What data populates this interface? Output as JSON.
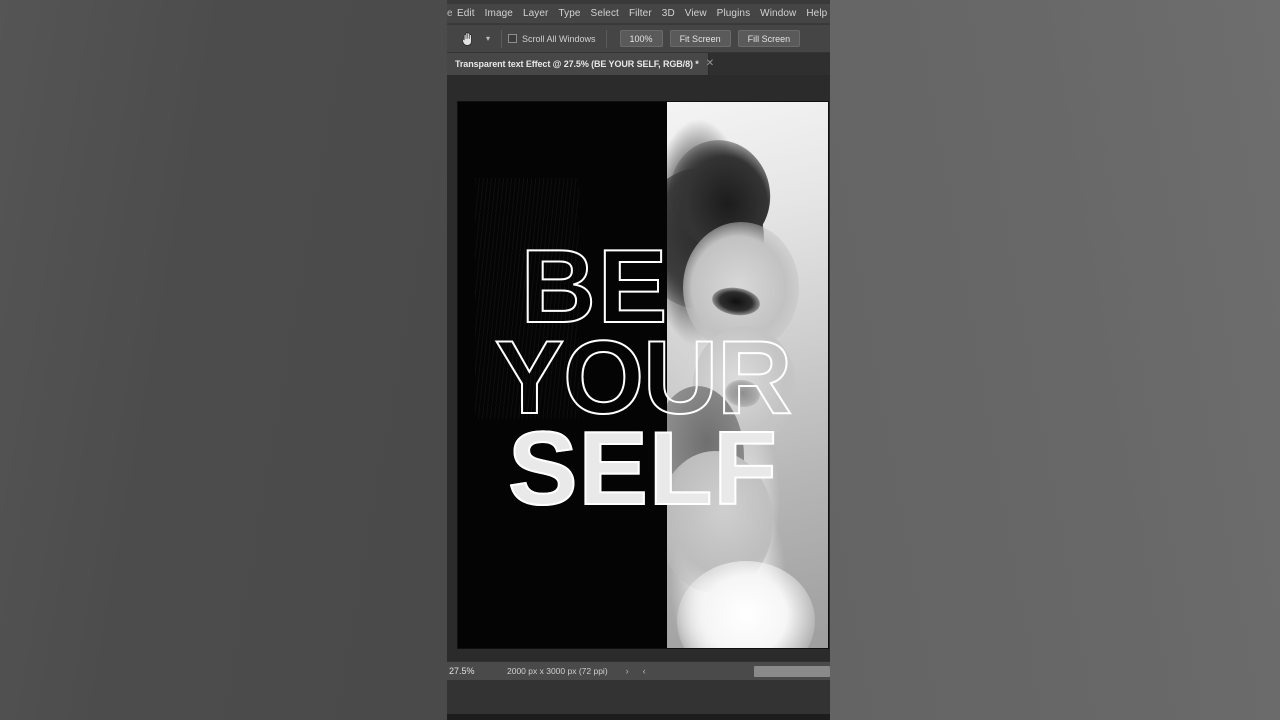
{
  "app": {
    "menu": {
      "truncated_first": "e",
      "items": [
        "Edit",
        "Image",
        "Layer",
        "Type",
        "Select",
        "Filter",
        "3D",
        "View",
        "Plugins",
        "Window",
        "Help"
      ]
    },
    "options_bar": {
      "tool_icon": "hand-tool-icon",
      "preset_chevron_icon": "chevron-down-icon",
      "scroll_all_windows_label": "Scroll All Windows",
      "scroll_all_windows_checked": false,
      "buttons": [
        "100%",
        "Fit Screen",
        "Fill Screen"
      ]
    },
    "tab": {
      "title": "Transparent text Effect @ 27.5% (BE YOUR SELF, RGB/8) *",
      "close_icon": "close-icon"
    },
    "status_bar": {
      "zoom": "27.5%",
      "doc_size": "2000 px x 3000 px (72 ppi)",
      "arrow_right_icon": "›",
      "arrow_left_icon": "‹"
    }
  },
  "artwork": {
    "headline": {
      "line1": "BE",
      "line2": "YOUR",
      "line3": "SELF"
    },
    "description": "Black-and-white fashion portrait split vertically: solid black left half, grayscale photo of a woman in profile with hair in a bun and white fur collar on the right; outlined headline text overlays the composition."
  },
  "colors": {
    "window_chrome": "#454545",
    "canvas_backdrop": "#2b2b2b",
    "tab_active": "#474747",
    "desktop_left": "#4e4e4e",
    "desktop_right": "#686868",
    "text_primary": "#e8e8e8",
    "artwork_black": "#040404",
    "artwork_white": "#ffffff"
  }
}
